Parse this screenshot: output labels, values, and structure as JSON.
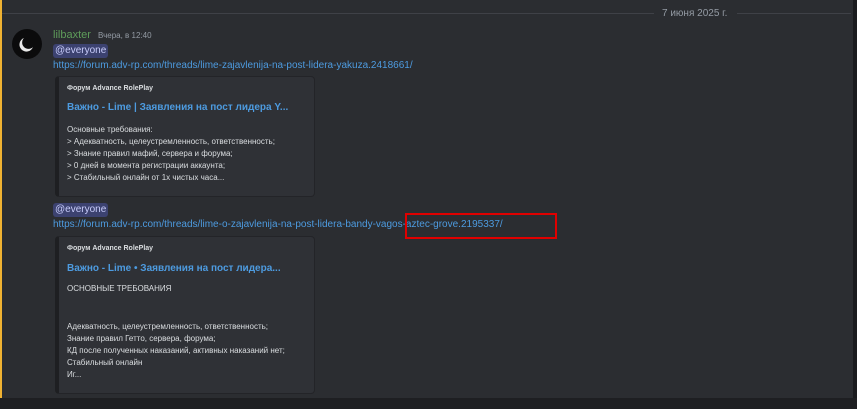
{
  "date_divider": "7 июня 2025 г.",
  "message": {
    "username": "lilbaxter",
    "timestamp": "Вчера, в 12:40",
    "posts": [
      {
        "mention": "@everyone",
        "link": "https://forum.adv-rp.com/threads/lime-zajavlenija-na-post-lidera-yakuza.2418661/",
        "embed": {
          "provider": "Форум Advance RolePlay",
          "title": "Важно - Lime | Заявления на пост лидера Y...",
          "lines": [
            "Основные требования:",
            "> Адекватность, целеустремленность, ответственность;",
            "> Знание правил мафий, сервера и форума;",
            "> 0 дней в момента регистрации аккаунта;",
            "> Стабильный онлайн от 1х чистых часа..."
          ]
        }
      },
      {
        "mention": "@everyone",
        "link": "https://forum.adv-rp.com/threads/lime-o-zajavlenija-na-post-lidera-bandy-vagos-aztec-grove.2195337/",
        "embed": {
          "provider": "Форум Advance RolePlay",
          "title": "Важно - Lime • Заявления на пост лидера...",
          "heading": "ОСНОВНЫЕ ТРЕБОВАНИЯ",
          "lines": [
            "Адекватность, целеустремленность, ответственность;",
            "Знание правил Гетто, сервера, форума;",
            "КД после полученных наказаний, активных наказаний нет;",
            "Стабильный онлайн",
            "Иг..."
          ]
        }
      }
    ]
  },
  "colors": {
    "accent": "#f0b232",
    "username": "#5e9c5a",
    "link": "#4d9be0",
    "highlight": "#e00000"
  }
}
